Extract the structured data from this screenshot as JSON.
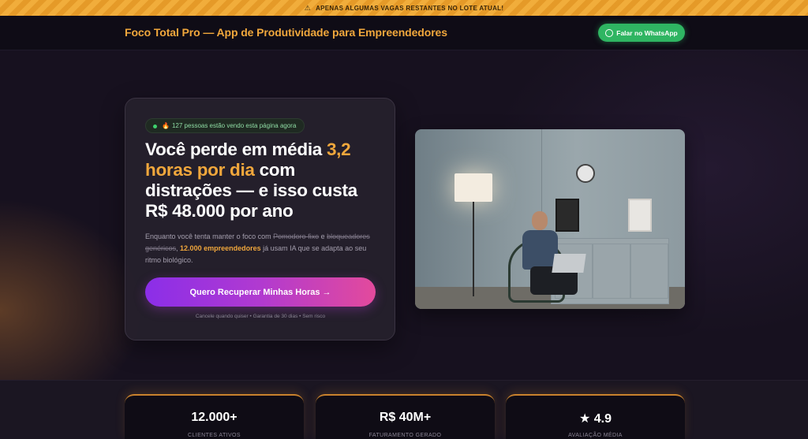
{
  "banner": {
    "icon": "warning-icon",
    "text": "APENAS ALGUMAS VAGAS RESTANTES NO LOTE ATUAL!"
  },
  "header": {
    "brand": "Foco Total Pro — App de Produtividade para Empreendedores",
    "whatsapp_label": "Falar no WhatsApp",
    "whatsapp_icon": "whatsapp-icon"
  },
  "hero": {
    "live_badge": "127 pessoas estão vendo esta página agora",
    "headline_pre": "Você perde em média ",
    "headline_highlight": "3,2 horas por dia",
    "headline_post": " com distrações — e isso custa R$ 48.000 por ano",
    "sub_pre": "Enquanto você tenta manter o foco com ",
    "sub_strike_1": "Pomodoro fixo",
    "sub_and": " e ",
    "sub_strike_2": "bloqueadores genéricos",
    "sub_comma": ", ",
    "sub_bold": "12.000 empreendedores",
    "sub_post": " já usam IA que se adapta ao seu ritmo biológico.",
    "cta_label": "Quero Recuperar Minhas Horas →",
    "cta_note": "Cancele quando quiser • Garantia de 30 dias • Sem risco"
  },
  "stats": [
    {
      "value": "12.000+",
      "label": "CLIENTES ATIVOS"
    },
    {
      "value": "R$ 40M+",
      "label": "FATURAMENTO GERADO"
    },
    {
      "value": "★ 4.9",
      "label": "AVALIAÇÃO MÉDIA"
    }
  ],
  "colors": {
    "accent": "#f0a73c",
    "whatsapp": "#2fb562",
    "cta_start": "#8b2ee8",
    "cta_end": "#e34a9c"
  }
}
